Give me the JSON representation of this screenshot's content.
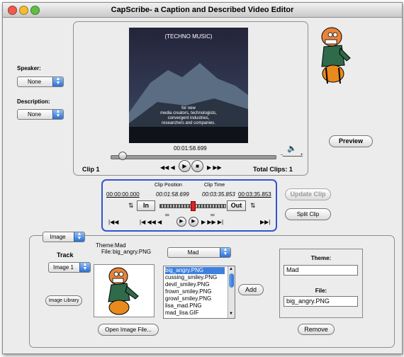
{
  "window": {
    "title": "CapScribe- a Caption and Described Video Editor"
  },
  "colors": {
    "accent": "#3d80df",
    "selection_border": "#3355cc",
    "close": "#ee5a4d",
    "minimize": "#f4bb35",
    "zoom": "#5fbe45"
  },
  "left_panel": {
    "speaker_label": "Speaker:",
    "speaker_value": "None",
    "description_label": "Description:",
    "description_value": "None"
  },
  "video": {
    "overlay_title": "(TECHNO MUSIC)",
    "overlay_lines": [
      "for new",
      "media creators, technologists,",
      "convergent industries,",
      "researchers and companies."
    ],
    "current_time": "00:01:58.699",
    "clip_label": "Clip 1",
    "total_clips": "Total Clips: 1",
    "volume_icon": "speaker-icon",
    "preview_label": "Preview"
  },
  "clip_editor": {
    "clip_position_label": "Clip Position",
    "clip_time_label": "Clip Time",
    "start_time": "00:00:00.000",
    "position_time": "00:01:58.699",
    "clip_time": "00:03:35.853",
    "end_time": "00:03:35.853",
    "in_label": "In",
    "out_label": "Out",
    "update_clip_label": "Update Clip",
    "split_clip_label": "Split Clip"
  },
  "media_panel": {
    "type_value": "Image",
    "theme_label": "Theme:",
    "theme_value": "Mad",
    "file_label": "File:",
    "file_value": "big_angry.PNG",
    "track_label": "Track",
    "track_value": "Image 1",
    "image_library_label": "Image Library",
    "open_image_label": "Open Image File...",
    "theme_popup_value": "Mad",
    "files": [
      "big_angry.PNG",
      "cussing_smiley.PNG",
      "devil_smiley.PNG",
      "frown_smiley.PNG",
      "growl_smiley.PNG",
      "lisa_mad.PNG",
      "mad_lisa.GIF"
    ],
    "add_label": "Add",
    "remove_label": "Remove",
    "right_theme_label": "Theme:",
    "right_theme_value": "Mad",
    "right_file_label": "File:",
    "right_file_value": "big_angry.PNG"
  }
}
